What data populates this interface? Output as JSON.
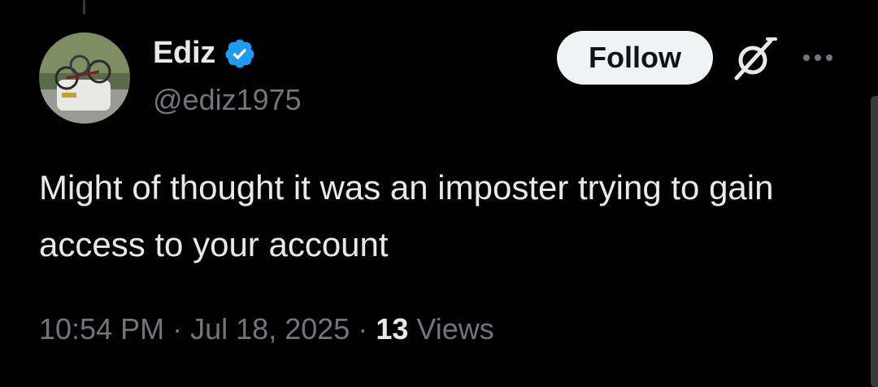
{
  "user": {
    "display_name": "Ediz",
    "handle": "@ediz1975",
    "verified": true,
    "verified_color": "#1d9bf0"
  },
  "actions": {
    "follow_label": "Follow"
  },
  "tweet": {
    "text": "Might of thought it was an imposter trying to gain access to your account",
    "time": "10:54 PM",
    "date": "Jul 18, 2025",
    "separator": "·",
    "views_count": "13",
    "views_label": "Views"
  },
  "icons": {
    "avatar": "avatar-photo",
    "badge": "verified-badge-icon",
    "grok": "grok-icon",
    "more": "more-options-icon"
  },
  "colors": {
    "background": "#000000",
    "text_primary": "#e7e9ea",
    "text_secondary": "#71767b",
    "follow_bg": "#eff3f4",
    "follow_text": "#0f1419"
  }
}
